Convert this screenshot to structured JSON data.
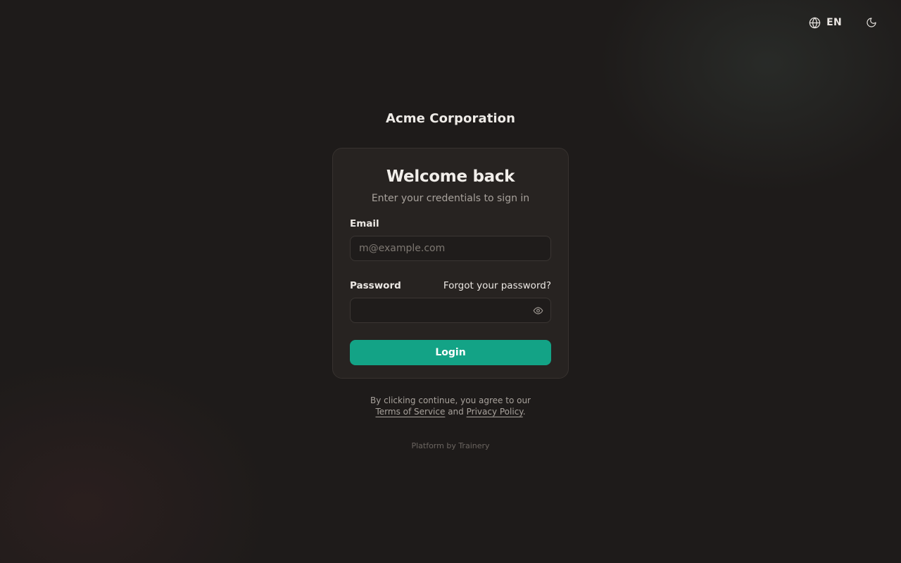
{
  "header": {
    "language_label": "EN",
    "language_icon": "globe-icon",
    "theme_icon": "moon-icon"
  },
  "org": {
    "name": "Acme Corporation"
  },
  "login": {
    "title": "Welcome back",
    "subtitle": "Enter your credentials to sign in",
    "email_label": "Email",
    "email_placeholder": "m@example.com",
    "email_value": "",
    "password_label": "Password",
    "password_value": "",
    "forgot_label": "Forgot your password?",
    "show_password_icon": "eye-icon",
    "submit_label": "Login"
  },
  "legal": {
    "prefix": "By clicking continue, you agree to our",
    "terms_label": "Terms of Service",
    "and": "and",
    "privacy_label": "Privacy Policy",
    "suffix": "."
  },
  "footer": {
    "platform_text": "Platform by Trainery"
  },
  "colors": {
    "background": "#1e1b1a",
    "card": "#272321",
    "accent": "#13a386",
    "text": "#ebe8e4",
    "muted": "#a8a29c"
  }
}
